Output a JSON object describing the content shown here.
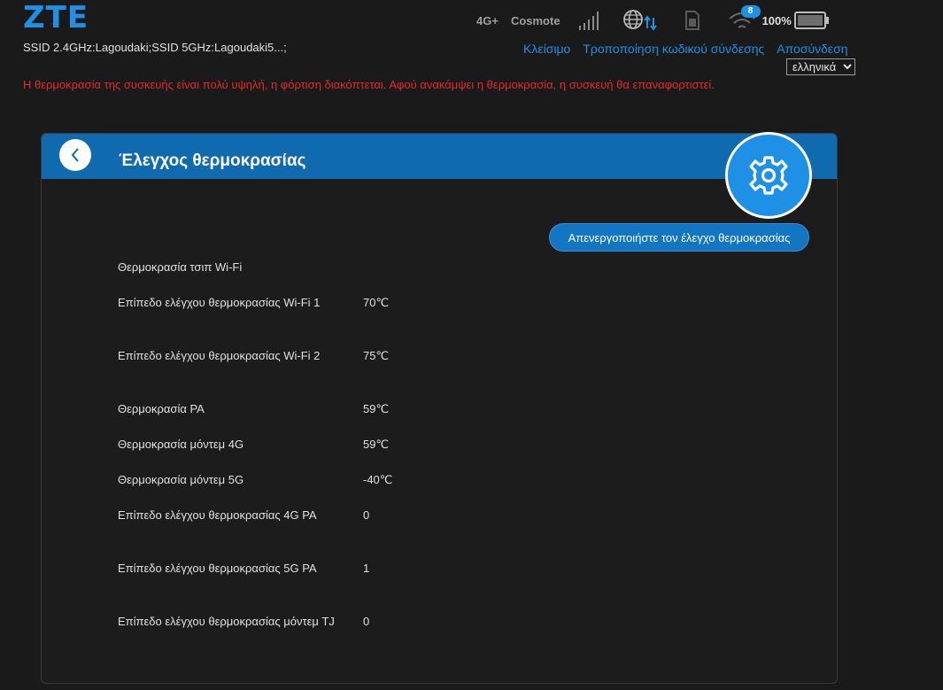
{
  "header": {
    "logo": "ZTE",
    "ssid": "SSID 2.4GHz:Lagoudaki;SSID 5GHz:Lagoudaki5...;",
    "network_type": "4G+",
    "operator": "Cosmote",
    "wifi_clients": "8",
    "battery": "100%",
    "links": {
      "shutdown": "Κλείσιμο",
      "change_password": "Τροποποίηση κωδικού σύνδεσης",
      "logout": "Αποσύνδεση"
    },
    "language": "ελληνικά"
  },
  "warning": "Η θερμοκρασία της συσκευής είναι πολύ υψηλή, η φόρτιση διακόπτεται. Αφού ανακάμψει η θερμοκρασία, η συσκευή θα επαναφορτιστεί.",
  "card": {
    "title": "Έλεγχος θερμοκρασίας",
    "disable_button": "Απενεργοποιήστε τον έλεγχο θερμοκρασίας",
    "rows": [
      {
        "label": "Θερμοκρασία τσιπ Wi-Fi",
        "value": ""
      },
      {
        "label": "Επίπεδο ελέγχου θερμοκρασίας Wi-Fi 1",
        "value": "70℃"
      },
      {
        "label": "Επίπεδο ελέγχου θερμοκρασίας Wi-Fi 2",
        "value": "75℃"
      },
      {
        "label": "Θερμοκρασία PA",
        "value": "59℃"
      },
      {
        "label": "Θερμοκρασία μόντεμ 4G",
        "value": "59℃"
      },
      {
        "label": "Θερμοκρασία μόντεμ 5G",
        "value": "-40℃"
      },
      {
        "label": "Επίπεδο ελέγχου θερμοκρασίας 4G PA",
        "value": "0"
      },
      {
        "label": "Επίπεδο ελέγχου θερμοκρασίας 5G PA",
        "value": "1"
      },
      {
        "label": "Επίπεδο ελέγχου θερμοκρασίας μόντεμ TJ",
        "value": "0"
      }
    ]
  },
  "colors": {
    "accent": "#1e90e6",
    "header_bar": "#0f6ab0",
    "warning": "#e32b2b",
    "background": "#1a1a1b"
  },
  "icons": [
    "signal-icon",
    "globe-icon",
    "sim-card-icon",
    "wifi-icon",
    "battery-icon",
    "back-icon",
    "gear-icon"
  ]
}
